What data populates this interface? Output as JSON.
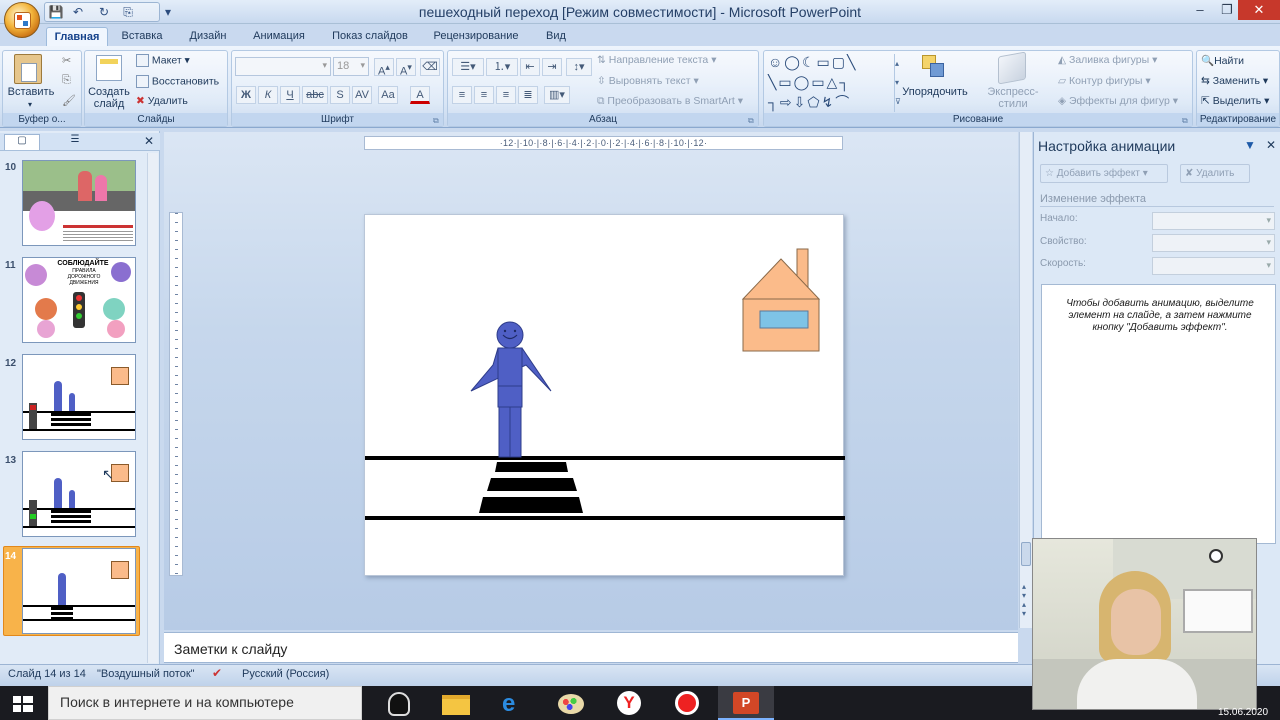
{
  "window": {
    "title": "пешеходный переход [Режим совместимости] - Microsoft PowerPoint"
  },
  "tabs": [
    "Главная",
    "Вставка",
    "Дизайн",
    "Анимация",
    "Показ слайдов",
    "Рецензирование",
    "Вид"
  ],
  "ribbon": {
    "clipboard": {
      "paste": "Вставить",
      "group": "Буфер о..."
    },
    "slides": {
      "new_slide": "Создать слайд",
      "layout": "Макет",
      "reset": "Восстановить",
      "delete": "Удалить",
      "group": "Слайды"
    },
    "font": {
      "font_size": "18",
      "group": "Шрифт"
    },
    "paragraph": {
      "text_direction": "Направление текста",
      "align_text": "Выровнять текст",
      "convert_smartart": "Преобразовать в SmartArt",
      "group": "Абзац"
    },
    "drawing": {
      "arrange": "Упорядочить",
      "quick_styles": "Экспресс-стили",
      "shape_fill": "Заливка фигуры",
      "shape_outline": "Контур фигуры",
      "shape_effects": "Эффекты для фигур",
      "group": "Рисование"
    },
    "editing": {
      "find": "Найти",
      "replace": "Заменить",
      "select": "Выделить",
      "group": "Редактирование"
    }
  },
  "slides_panel": {
    "numbers": [
      "10",
      "11",
      "12",
      "13",
      "14"
    ],
    "slide11_title": "СОБЛЮДАЙТЕ",
    "slide11_sub": "ПРАВИЛА ДОРОЖНОГО ДВИЖЕНИЯ"
  },
  "ruler": {
    "labels": "·12·|·10·|·8·|·6·|·4·|·2·|·0·|·2·|·4·|·6·|·8·|·10·|·12·"
  },
  "notes": {
    "placeholder": "Заметки к слайду"
  },
  "task_pane": {
    "title": "Настройка анимации",
    "add_effect": "Добавить эффект",
    "remove": "Удалить",
    "modify_label": "Изменение эффекта",
    "start_label": "Начало:",
    "property_label": "Свойство:",
    "speed_label": "Скорость:",
    "hint": "Чтобы добавить анимацию, выделите элемент на слайде, а затем нажмите кнопку \"Добавить эффект\"."
  },
  "status_bar": {
    "slide_info": "Слайд 14 из 14",
    "theme": "\"Воздушный поток\"",
    "language": "Русский (Россия)"
  },
  "taskbar": {
    "search_placeholder": "Поиск в интернете и на компьютере",
    "date": "15.06.2020"
  },
  "colors": {
    "figure": "#4f5fc5",
    "house": "#fbbb8a",
    "window": "#7ec3e6",
    "accent_selected": "#f8b34a"
  }
}
